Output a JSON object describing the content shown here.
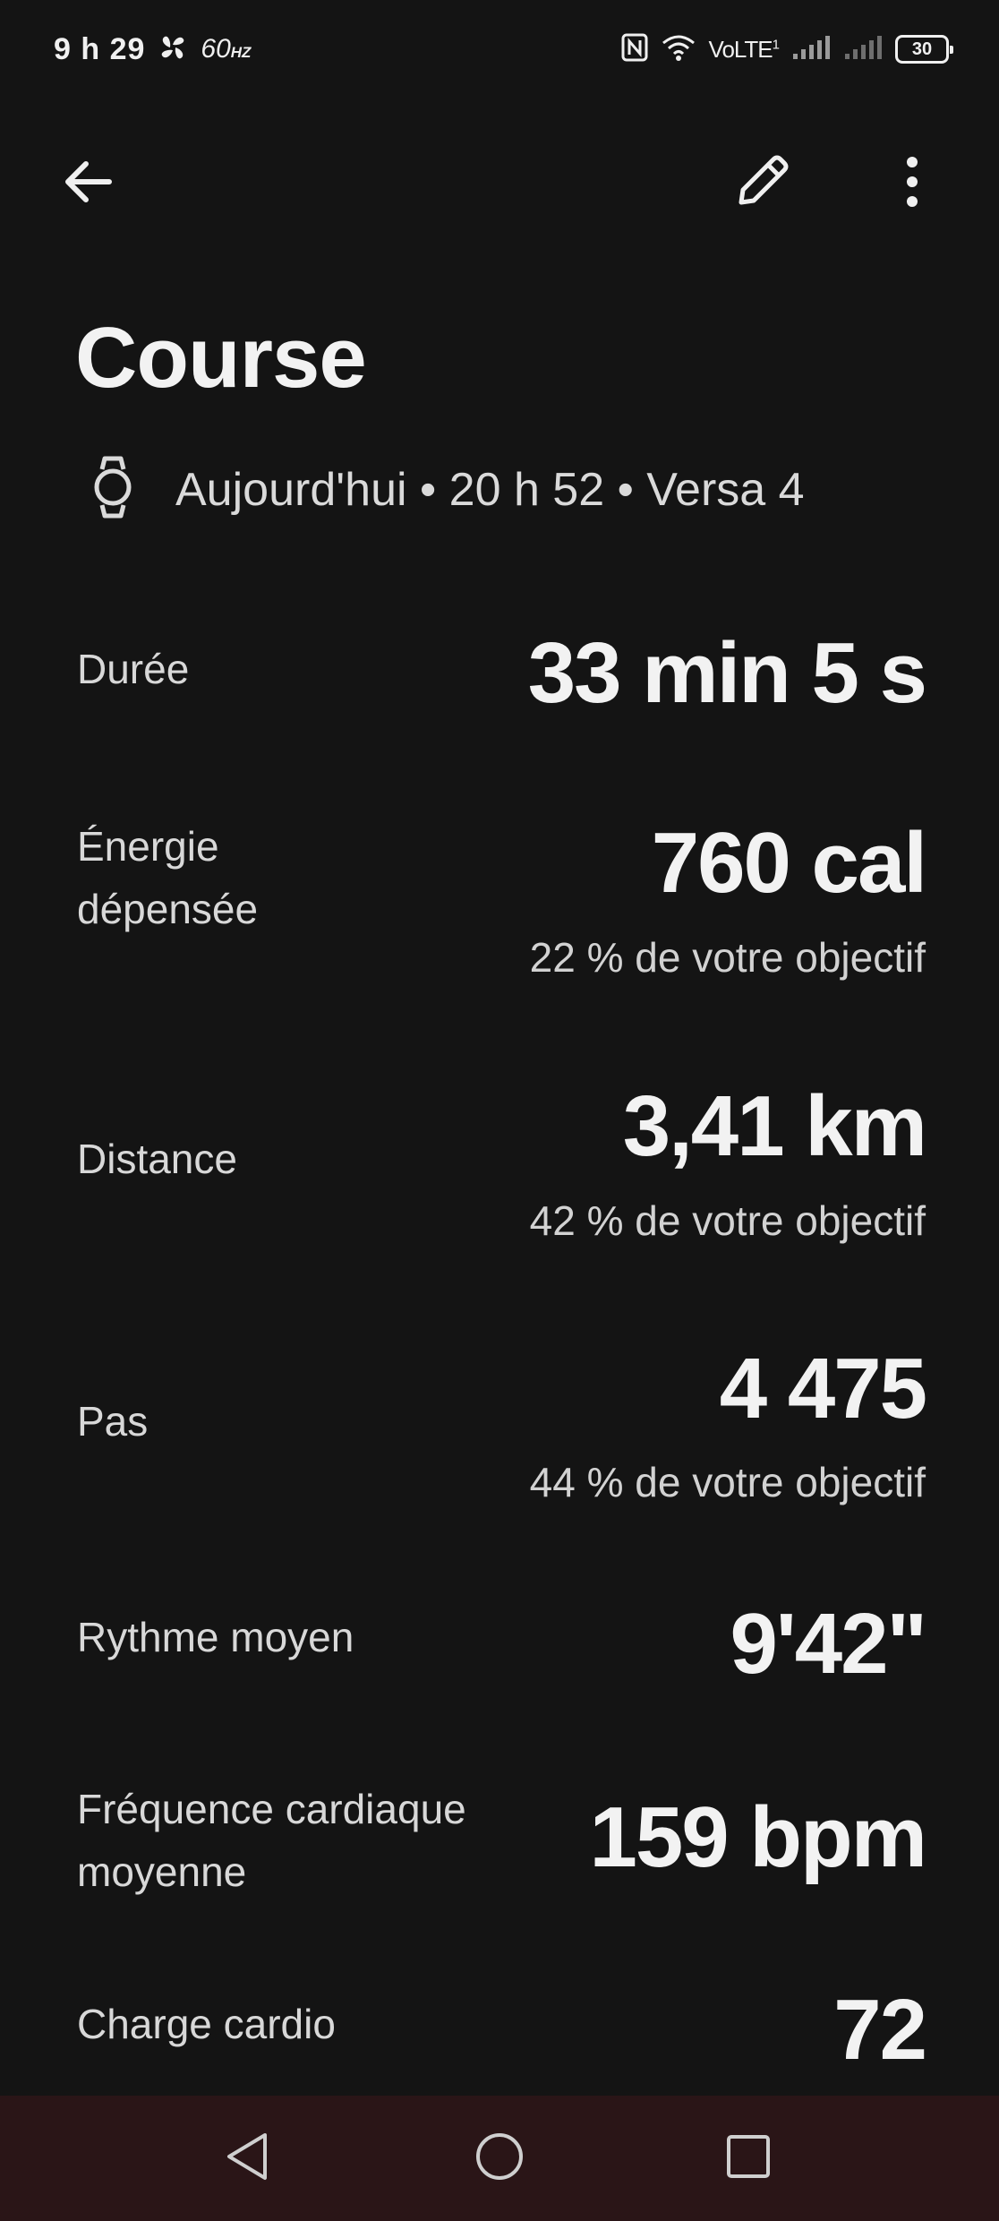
{
  "status_bar": {
    "time": "9 h 29",
    "refresh_rate": "60",
    "refresh_unit": "HZ",
    "network": "VoLTE",
    "network_sim": "1",
    "battery": "30"
  },
  "header": {
    "title": "Course",
    "subtitle": "Aujourd'hui • 20 h 52 • Versa 4"
  },
  "metrics": [
    {
      "label": "Durée",
      "value": "33 min 5 s",
      "sub": ""
    },
    {
      "label": "Énergie\ndépensée",
      "value": "760 cal",
      "sub": "22 % de votre objectif"
    },
    {
      "label": "Distance",
      "value": "3,41 km",
      "sub": "42 % de votre objectif"
    },
    {
      "label": "Pas",
      "value": "4 475",
      "sub": "44 % de votre objectif"
    },
    {
      "label": "Rythme moyen",
      "value": "9'42\"",
      "sub": ""
    },
    {
      "label": "Fréquence cardiaque\nmoyenne",
      "value": "159 bpm",
      "sub": ""
    },
    {
      "label": "Charge cardio",
      "value": "72",
      "sub": ""
    }
  ],
  "colors": {
    "background": "#141414",
    "nav_bar": "#2a1517",
    "text_primary": "#f2f2f2"
  },
  "icons": {
    "back": "arrow-left-icon",
    "edit": "pencil-icon",
    "more": "more-vert-icon",
    "device": "watch-icon"
  }
}
